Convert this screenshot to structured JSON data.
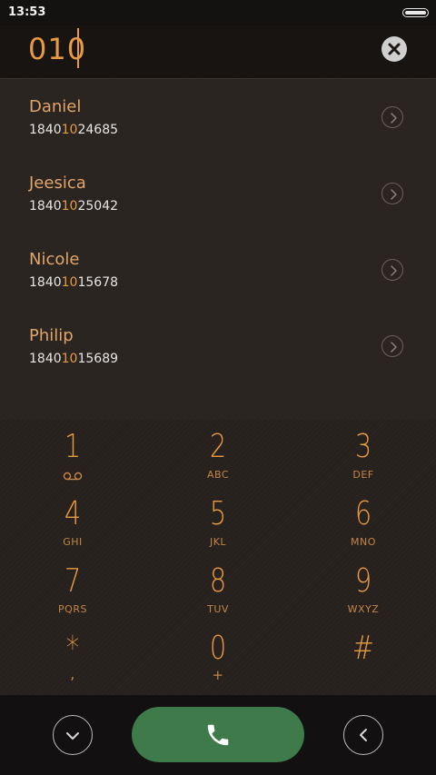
{
  "status_bar": {
    "time": "13:53"
  },
  "dialer": {
    "input_value": "010"
  },
  "contacts": [
    {
      "name": "Daniel",
      "number_prefix": "1840",
      "number_match": "10",
      "number_suffix": "24685"
    },
    {
      "name": "Jeesica",
      "number_prefix": "1840",
      "number_match": "10",
      "number_suffix": "25042"
    },
    {
      "name": "Nicole",
      "number_prefix": "1840",
      "number_match": "10",
      "number_suffix": "15678"
    },
    {
      "name": "Philip",
      "number_prefix": "1840",
      "number_match": "10",
      "number_suffix": "15689"
    }
  ],
  "keypad": [
    {
      "digit": "1",
      "letters": ""
    },
    {
      "digit": "2",
      "letters": "ABC"
    },
    {
      "digit": "3",
      "letters": "DEF"
    },
    {
      "digit": "4",
      "letters": "GHI"
    },
    {
      "digit": "5",
      "letters": "JKL"
    },
    {
      "digit": "6",
      "letters": "MNO"
    },
    {
      "digit": "7",
      "letters": "PQRS"
    },
    {
      "digit": "8",
      "letters": "TUV"
    },
    {
      "digit": "9",
      "letters": "WXYZ"
    },
    {
      "digit": "*",
      "letters": ","
    },
    {
      "digit": "0",
      "letters": "+"
    },
    {
      "digit": "#",
      "letters": ""
    }
  ],
  "icons": {
    "voicemail": "voicemail-icon",
    "clear": "clear-icon",
    "chevron_right": "chevron-right-icon",
    "collapse": "chevron-down-icon",
    "call": "phone-icon",
    "back": "chevron-left-icon"
  },
  "colors": {
    "accent": "#e79a42",
    "call_button": "#3e7a4a",
    "background": "#1e1a18"
  }
}
